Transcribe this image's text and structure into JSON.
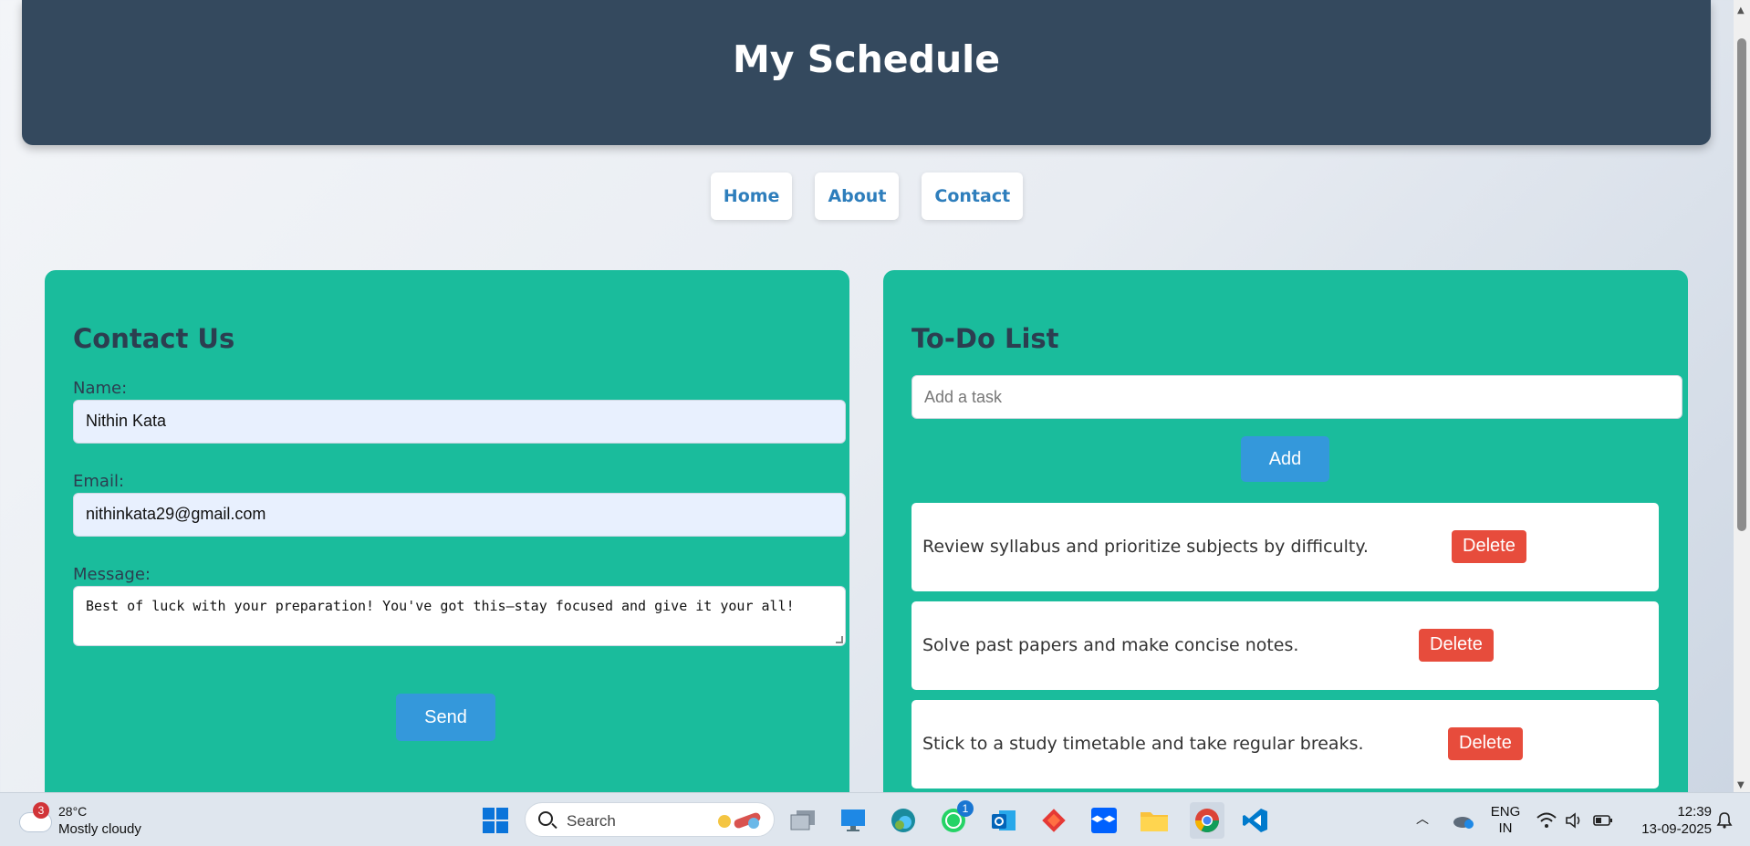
{
  "header": {
    "title": "My Schedule"
  },
  "nav": {
    "items": [
      "Home",
      "About",
      "Contact"
    ]
  },
  "contact": {
    "title": "Contact Us",
    "name_label": "Name:",
    "name_value": "Nithin Kata",
    "email_label": "Email:",
    "email_value": "nithinkata29@gmail.com",
    "message_label": "Message:",
    "message_value": "Best of luck with your preparation! You've got this—stay focused and give it your all!",
    "send_label": "Send"
  },
  "todo": {
    "title": "To-Do List",
    "input_placeholder": "Add a task",
    "add_label": "Add",
    "delete_label": "Delete",
    "tasks": [
      "Review syllabus and prioritize subjects by difficulty.",
      "Solve past papers and make concise notes.",
      "Stick to a study timetable and take regular breaks."
    ]
  },
  "taskbar": {
    "weather_badge": "3",
    "temperature": "28°C",
    "condition": "Mostly cloudy",
    "search_label": "Search",
    "whatsapp_badge": "1",
    "language_top": "ENG",
    "language_bottom": "IN",
    "time": "12:39",
    "date": "13-09-2025",
    "icons": [
      "windows-start",
      "task-view",
      "desktop",
      "edge",
      "whatsapp",
      "outlook",
      "git",
      "dropbox",
      "file-explorer",
      "chrome",
      "vscode"
    ]
  },
  "colors": {
    "header_bg": "#34495e",
    "card_bg": "#1abc9c",
    "button_blue": "#3498db",
    "delete_red": "#e74c3c",
    "nav_text": "#2e7ebc"
  }
}
